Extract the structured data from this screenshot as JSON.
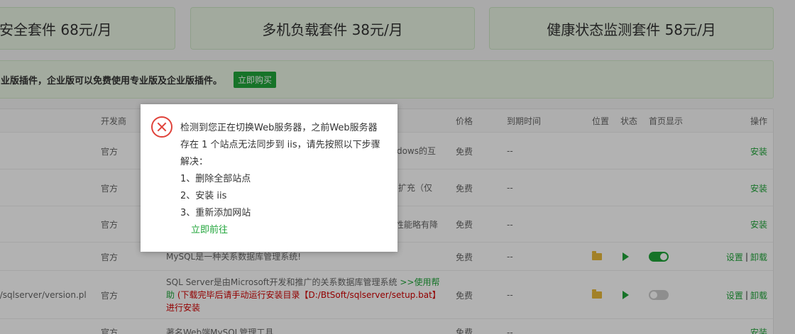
{
  "packs": [
    "安全套件 68元/月",
    "多机负载套件 38元/月",
    "健康状态监测套件 58元/月"
  ],
  "notice": {
    "text": "业版插件，企业版可以免费使用专业版及企业版插件。",
    "buy": "立即购买"
  },
  "header": {
    "dev": "开发商",
    "price": "价格",
    "expire": "到期时间",
    "pos": "位置",
    "status": "状态",
    "home": "首页显示",
    "op": "操作"
  },
  "rows": [
    {
      "name": "",
      "dev": "官方",
      "desc": "dows的互",
      "price": "免费",
      "expire": "--",
      "op": "安装"
    },
    {
      "name": "",
      "dev": "官方",
      "desc": "PI扩充（仅",
      "price": "免费",
      "expire": "--",
      "op": "安装"
    },
    {
      "name": "",
      "dev": "官方",
      "desc": "下性能略有降",
      "price": "免费",
      "expire": "--",
      "op": "安装"
    },
    {
      "name": "",
      "dev": "官方",
      "desc": "MySQL是一种关系数据库管理系统!",
      "price": "免费",
      "expire": "--",
      "op1": "设置",
      "op2": "卸载",
      "toggle": "on"
    },
    {
      "name": "ft/sqlserver/version.pl",
      "dev": "官方",
      "desc_a": "SQL Server是由Microsoft开发和推广的关系数据库管理系统",
      "desc_b": " >>使用帮助",
      "desc_c": " (下载完毕后请手动运行安装目录【D:/BtSoft/sqlserver/setup.bat】进行安装",
      "price": "免费",
      "expire": "--",
      "op1": "设置",
      "op2": "卸载",
      "toggle": "off"
    },
    {
      "name": "",
      "dev": "官方",
      "desc": "著名Web端MySQL管理工具",
      "price": "免费",
      "expire": "--",
      "op": "安装"
    }
  ],
  "dialog": {
    "line1": "检测到您正在切换Web服务器，之前Web服务器存在 1 个站点无法同步到 iis，请先按照以下步骤解决：",
    "step1": "1、删除全部站点",
    "step2": "2、安装 iis",
    "step3": "3、重新添加网站",
    "go": "立即前往"
  },
  "colors": {
    "accent": "#20a53a",
    "error": "#e0433b",
    "danger": "#d20000"
  }
}
